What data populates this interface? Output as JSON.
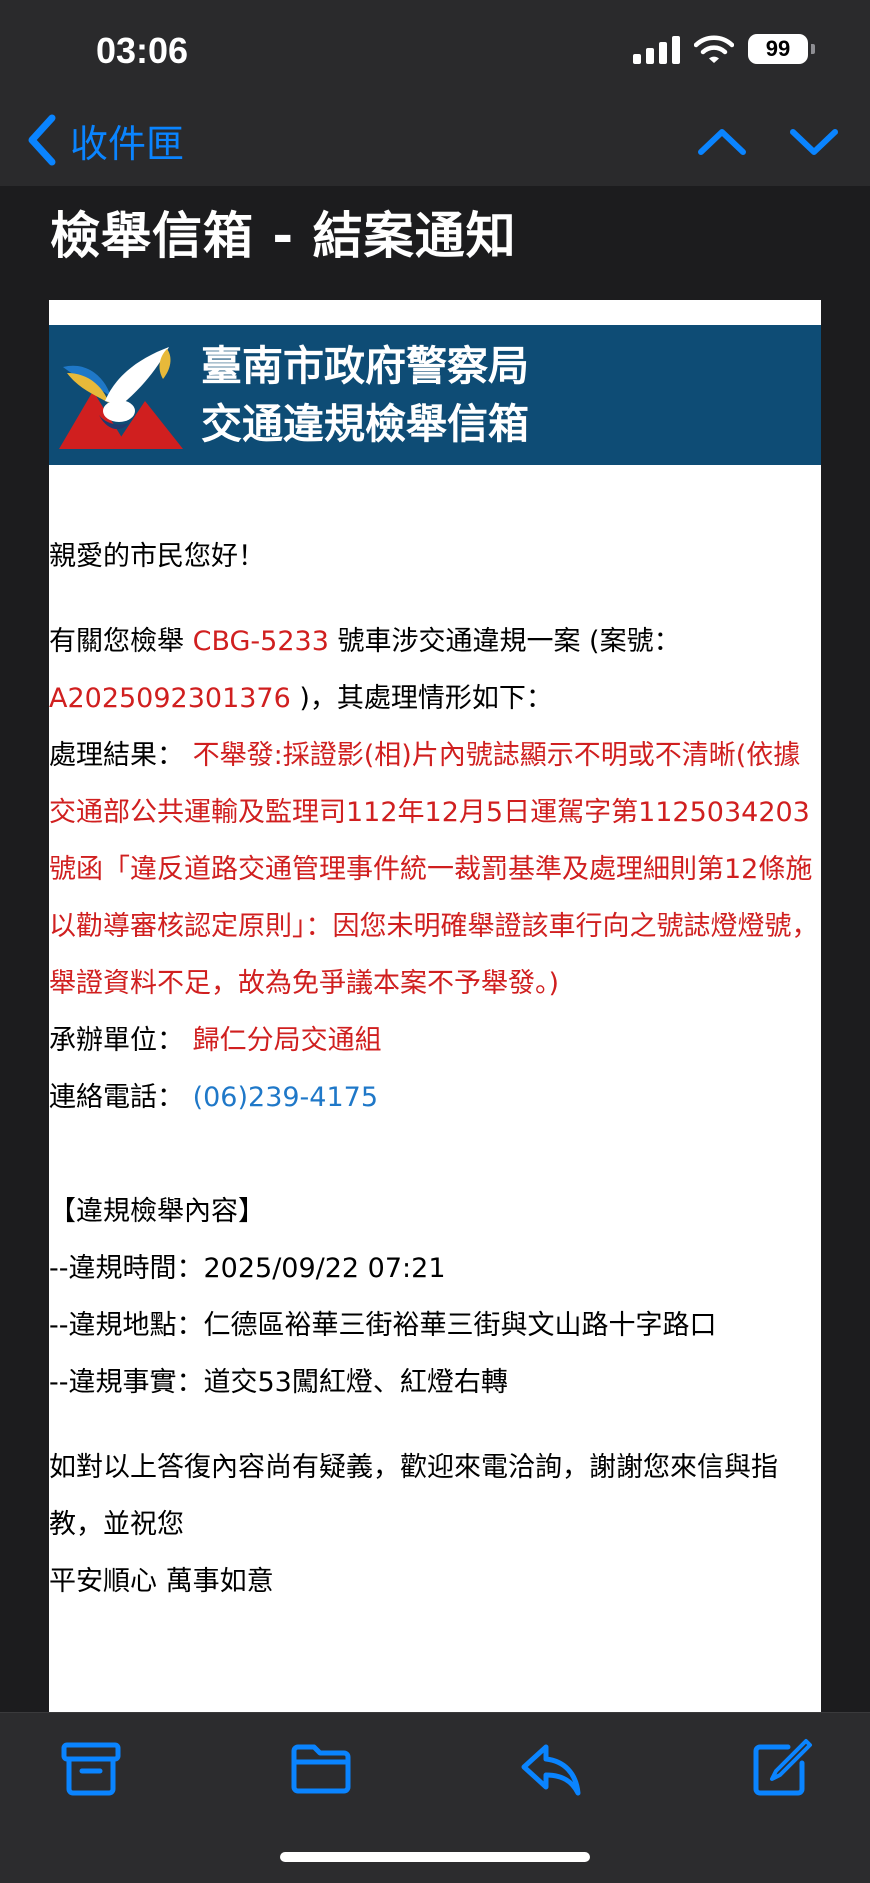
{
  "status_bar": {
    "time": "03:06",
    "battery": "99"
  },
  "nav": {
    "back_label": "收件匣"
  },
  "email": {
    "subject": "檢舉信箱 - 結案通知",
    "banner": {
      "line1": "臺南市政府警察局",
      "line2": "交通違規檢舉信箱"
    },
    "greeting": "親愛的市民您好！",
    "intro_pre": "有關您檢舉 ",
    "plate": "CBG-5233",
    "intro_mid": " 號車涉交通違規一案 (案號：",
    "case_no": "A2025092301376",
    "intro_post": " )，其處理情形如下：",
    "result_label": "處理結果：",
    "result_text": "不舉發:採證影(相)片內號誌顯示不明或不清晰(依據交通部公共運輸及監理司112年12月5日運駕字第1125034203號函「違反道路交通管理事件統一裁罰基準及處理細則第12條施以勸導審核認定原則」：因您未明確舉證該車行向之號誌燈燈號，舉證資料不足，故為免爭議本案不予舉發。)",
    "unit_label": "承辦單位：",
    "unit": "歸仁分局交通組",
    "phone_label": "連絡電話：",
    "phone": "(06)239-4175",
    "section_title": "【違規檢舉內容】",
    "details": [
      "--違規時間：2025/09/22 07:21",
      "--違規地點：仁德區裕華三街裕華三街與文山路十字路口",
      "--違規事實：道交53闖紅燈、紅燈右轉"
    ],
    "closing1": "如對以上答復內容尚有疑義，歡迎來電洽詢，謝謝您來信與指教，並祝您",
    "closing2": "平安順心 萬事如意"
  },
  "colors": {
    "accent": "#0a84ff",
    "banner": "#0e4c75",
    "highlight_red": "#d01f1f",
    "link_blue": "#1f78c8"
  },
  "icons": [
    "chevron-left-icon",
    "chevron-up-icon",
    "chevron-down-icon",
    "archive-icon",
    "folder-icon",
    "reply-icon",
    "compose-icon"
  ]
}
